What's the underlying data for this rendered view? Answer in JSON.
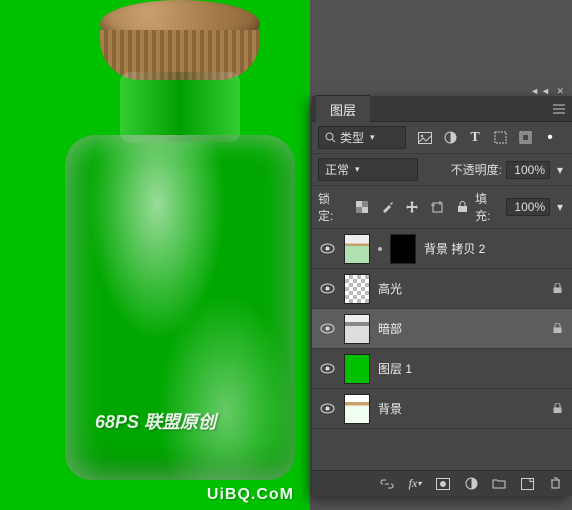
{
  "canvas": {
    "bg_color": "#00c000",
    "watermark1": "68PS 联盟原创",
    "watermark2": "UiBQ.CoM"
  },
  "panel": {
    "tab_label": "图层",
    "pin_chars": "◄◄ ✕",
    "filter": {
      "icon_name": "search-icon",
      "label": "类型",
      "icons": [
        "image-icon",
        "adjust-icon",
        "type-icon",
        "shape-icon",
        "smart-icon",
        "dot-icon"
      ]
    },
    "blend": {
      "mode": "正常",
      "opacity_label": "不透明度:",
      "opacity_value": "100%"
    },
    "lock": {
      "label": "锁定:",
      "icons": [
        "checker-icon",
        "brush-icon",
        "move-icon",
        "crop-icon",
        "lock-icon"
      ],
      "fill_label": "填充:",
      "fill_value": "100%"
    },
    "layers": [
      {
        "name": "背景 拷贝 2",
        "thumbs": [
          "bottle-thumb",
          "mask"
        ],
        "selected": false,
        "locked": false
      },
      {
        "name": "高光",
        "thumbs": [
          "checker"
        ],
        "selected": false,
        "locked": true
      },
      {
        "name": "暗部",
        "thumbs": [
          "bottle-thumb2"
        ],
        "selected": true,
        "locked": true
      },
      {
        "name": "图层 1",
        "thumbs": [
          "green"
        ],
        "selected": false,
        "locked": false
      },
      {
        "name": "背景",
        "thumbs": [
          "bottle-thumb3"
        ],
        "selected": false,
        "locked": true
      }
    ],
    "bottom_icons": [
      "link-icon",
      "fx-icon",
      "mask-add-icon",
      "adjustment-icon",
      "group-icon",
      "new-layer-icon",
      "trash-icon"
    ]
  }
}
